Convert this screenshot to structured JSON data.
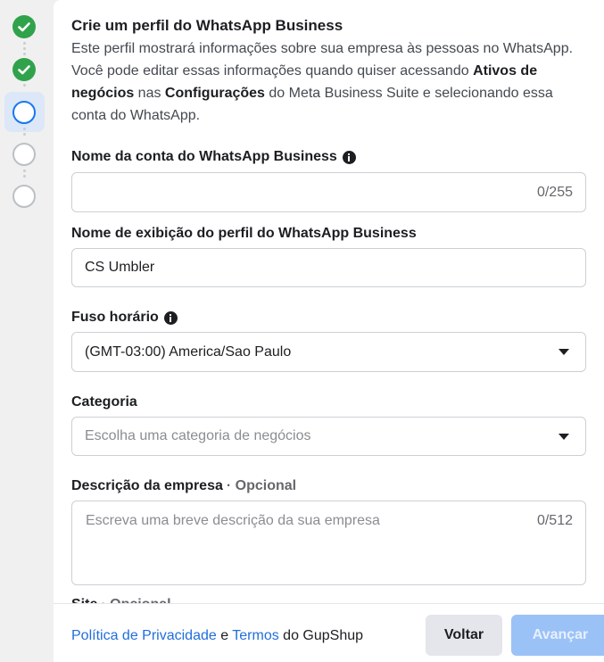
{
  "form": {
    "title": "Crie um perfil do WhatsApp Business",
    "intro": {
      "part1": "Este perfil mostrará informações sobre sua empresa às pessoas no WhatsApp. Você pode editar essas informações quando quiser acessando ",
      "bold1": "Ativos de negócios",
      "part2": " nas ",
      "bold2": "Configurações",
      "part3": " do Meta Business Suite e selecionando essa conta do WhatsApp."
    },
    "account_name": {
      "label": "Nome da conta do WhatsApp Business",
      "value": "",
      "counter": "0/255"
    },
    "display_name": {
      "label": "Nome de exibição do perfil do WhatsApp Business",
      "value": "CS Umbler"
    },
    "timezone": {
      "label": "Fuso horário",
      "value": "(GMT-03:00) America/Sao Paulo"
    },
    "category": {
      "label": "Categoria",
      "placeholder": "Escolha uma categoria de negócios"
    },
    "description": {
      "label": "Descrição da empresa",
      "optional": "· Opcional",
      "placeholder": "Escreva uma breve descrição da sua empresa",
      "counter": "0/512"
    },
    "site": {
      "label": "Site",
      "optional": "· Opcional"
    }
  },
  "footer": {
    "privacy_link": "Política de Privacidade",
    "and": " e ",
    "terms_link": "Termos",
    "suffix": " do GupShup",
    "back_label": "Voltar",
    "next_label": "Avançar"
  },
  "stepper": {
    "steps": [
      "complete",
      "complete",
      "current",
      "pending",
      "pending"
    ]
  },
  "colors": {
    "accent": "#1877f2",
    "success": "#31a24c",
    "disabled_primary": "#9bc2f7"
  }
}
